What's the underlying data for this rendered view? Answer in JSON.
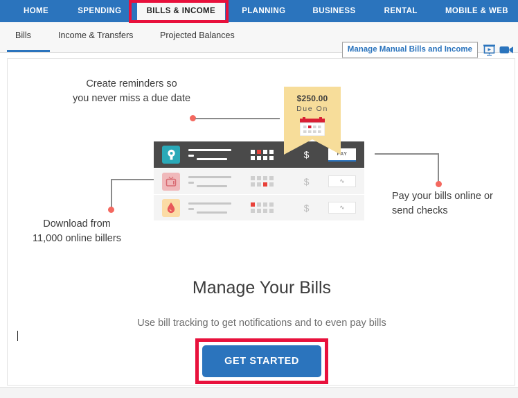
{
  "topnav": {
    "items": [
      {
        "label": "HOME",
        "active": false
      },
      {
        "label": "SPENDING",
        "active": false
      },
      {
        "label": "BILLS & INCOME",
        "active": true
      },
      {
        "label": "PLANNING",
        "active": false
      },
      {
        "label": "BUSINESS",
        "active": false
      },
      {
        "label": "RENTAL",
        "active": false
      },
      {
        "label": "MOBILE & WEB",
        "active": false
      }
    ],
    "accent_color": "#2b74bd",
    "annotation_color": "#e8113c"
  },
  "subnav": {
    "tabs": [
      {
        "label": "Bills",
        "active": true
      },
      {
        "label": "Income & Transfers",
        "active": false
      },
      {
        "label": "Projected Balances",
        "active": false
      }
    ],
    "manage_link": "Manage Manual Bills and Income",
    "icons": [
      {
        "name": "presentation-icon"
      },
      {
        "name": "video-camera-icon"
      }
    ]
  },
  "illustration": {
    "callout_top": "Create reminders so\nyou never miss a due date",
    "callout_left": "Download from\n11,000 online billers",
    "callout_right": "Pay your bills online or\nsend checks",
    "badge": {
      "amount": "$250.00",
      "label": "Due On",
      "bg_color": "#f7dd9a",
      "calendar_color": "#d91f33"
    },
    "rows": [
      {
        "icon": "lightbulb-icon",
        "tile_color": "#2aa9b8",
        "currency": "$",
        "action": "PAY",
        "highlight": true
      },
      {
        "icon": "television-icon",
        "tile_color": "#f0b9bb",
        "currency": "$",
        "action": "∿",
        "highlight": false
      },
      {
        "icon": "water-drop-icon",
        "tile_color": "#fbdca6",
        "currency": "$",
        "action": "∿",
        "highlight": false
      }
    ],
    "connector_dot_color": "#f4685f"
  },
  "cta": {
    "title": "Manage Your Bills",
    "subtitle": "Use bill tracking to get notifications and to even pay bills",
    "button_label": "GET STARTED",
    "button_color": "#2b74bd"
  }
}
